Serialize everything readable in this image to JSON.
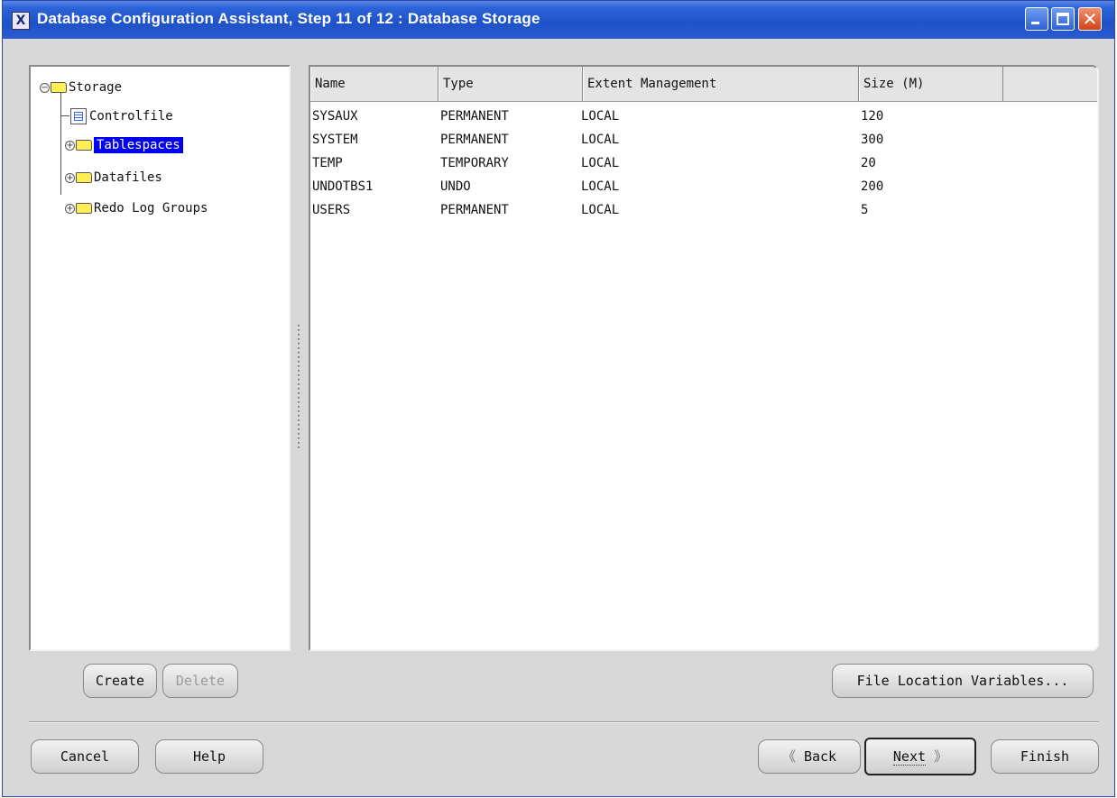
{
  "window": {
    "title": "Database Configuration Assistant, Step 11 of 12 : Database Storage",
    "app_icon": "X",
    "close_glyph": "✕"
  },
  "tree": {
    "root": {
      "label": "Storage",
      "expander": "−"
    },
    "items": [
      {
        "label": "Controlfile",
        "icon": "document-icon"
      },
      {
        "label": "Tablespaces",
        "icon": "folder-icon",
        "expander": "+",
        "selected": true
      },
      {
        "label": "Datafiles",
        "icon": "folder-icon",
        "expander": "+"
      },
      {
        "label": "Redo Log Groups",
        "icon": "folder-icon",
        "expander": "+"
      }
    ]
  },
  "table": {
    "headers": [
      "Name",
      "Type",
      "Extent Management",
      "Size (M)"
    ],
    "rows": [
      [
        "SYSAUX",
        "PERMANENT",
        "LOCAL",
        "120"
      ],
      [
        "SYSTEM",
        "PERMANENT",
        "LOCAL",
        "300"
      ],
      [
        "TEMP",
        "TEMPORARY",
        "LOCAL",
        "20"
      ],
      [
        "UNDOTBS1",
        "UNDO",
        "LOCAL",
        "200"
      ],
      [
        "USERS",
        "PERMANENT",
        "LOCAL",
        "5"
      ]
    ]
  },
  "buttons": {
    "create": "Create",
    "delete": "Delete",
    "file_location": "File Location Variables...",
    "cancel": "Cancel",
    "help": "Help",
    "back": "Back",
    "back_glyph": "《",
    "next": "Next",
    "next_glyph": "》",
    "finish": "Finish"
  },
  "colors": {
    "titlebar": "#1f52c8",
    "selection": "#0000ee",
    "folder": "#ffee55"
  }
}
